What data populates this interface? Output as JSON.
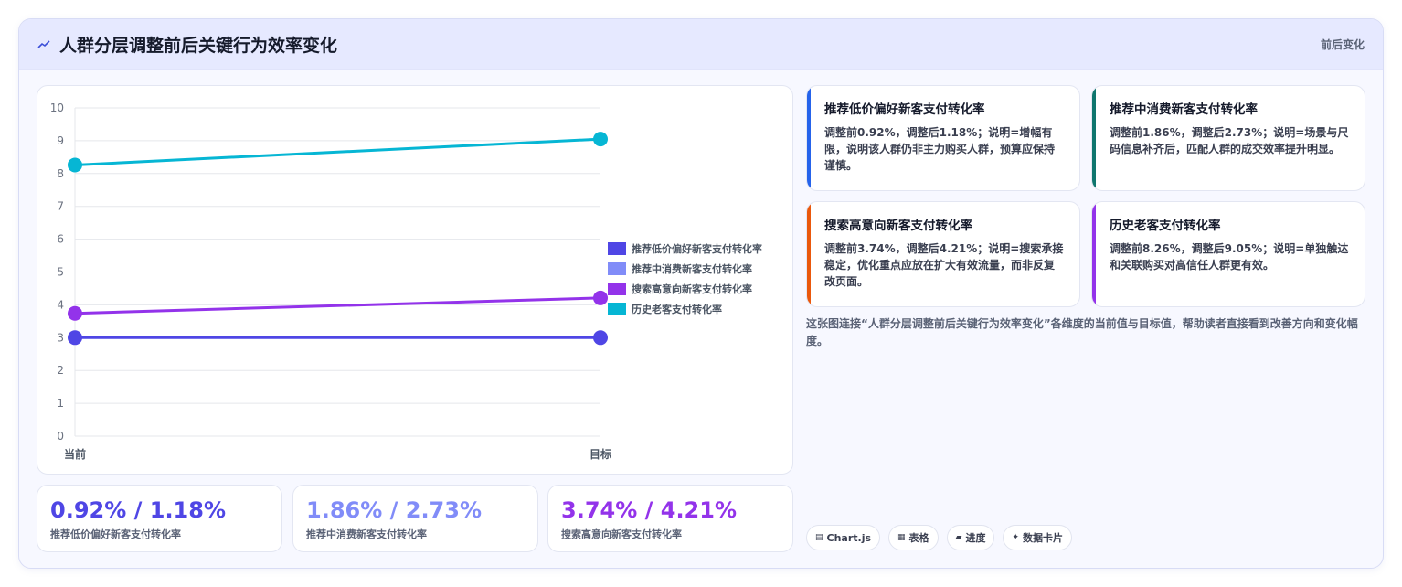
{
  "header": {
    "title": "人群分层调整前后关键行为效率变化",
    "badge": "前后变化",
    "icon": "trend-icon"
  },
  "chart_data": {
    "type": "line",
    "categories": [
      "当前",
      "目标"
    ],
    "ylim": [
      0,
      10
    ],
    "yticks": [
      0,
      1,
      2,
      3,
      4,
      5,
      6,
      7,
      8,
      9,
      10
    ],
    "grid": true,
    "legend_position": "right",
    "series": [
      {
        "name": "推荐低价偏好新客支付转化率",
        "values": [
          3,
          3
        ],
        "color": "#4f46e5"
      },
      {
        "name": "推荐中消费新客支付转化率",
        "values": [
          null,
          null
        ],
        "color": "#818cf8"
      },
      {
        "name": "搜索高意向新客支付转化率",
        "values": [
          3.74,
          4.21
        ],
        "color": "#9333ea"
      },
      {
        "name": "历史老客支付转化率",
        "values": [
          8.26,
          9.05
        ],
        "color": "#06b6d4"
      }
    ]
  },
  "stats": [
    {
      "value": "0.92% / 1.18%",
      "label": "推荐低价偏好新客支付转化率",
      "color": "#4f46e5"
    },
    {
      "value": "1.86% / 2.73%",
      "label": "推荐中消费新客支付转化率",
      "color": "#818cf8"
    },
    {
      "value": "3.74% / 4.21%",
      "label": "搜索高意向新客支付转化率",
      "color": "#9333ea"
    }
  ],
  "cards": [
    {
      "title": "推荐低价偏好新客支付转化率",
      "body": "调整前0.92%，调整后1.18%；说明=增幅有限，说明该人群仍非主力购买人群，预算应保持谨慎。",
      "color": "#2563eb"
    },
    {
      "title": "推荐中消费新客支付转化率",
      "body": "调整前1.86%，调整后2.73%；说明=场景与尺码信息补齐后，匹配人群的成交效率提升明显。",
      "color": "#0f766e"
    },
    {
      "title": "搜索高意向新客支付转化率",
      "body": "调整前3.74%，调整后4.21%；说明=搜索承接稳定，优化重点应放在扩大有效流量，而非反复改页面。",
      "color": "#ea580c"
    },
    {
      "title": "历史老客支付转化率",
      "body": "调整前8.26%，调整后9.05%；说明=单独触达和关联购买对高信任人群更有效。",
      "color": "#9333ea"
    }
  ],
  "note": "这张图连接“人群分层调整前后关键行为效率变化”各维度的当前值与目标值，帮助读者直接看到改善方向和变化幅度。",
  "tags": [
    {
      "icon": "chart-icon",
      "glyph": "▤",
      "label": "Chart.js"
    },
    {
      "icon": "table-icon",
      "glyph": "▦",
      "label": "表格"
    },
    {
      "icon": "progress-icon",
      "glyph": "▰",
      "label": "进度"
    },
    {
      "icon": "card-icon",
      "glyph": "✦",
      "label": "数据卡片"
    }
  ]
}
